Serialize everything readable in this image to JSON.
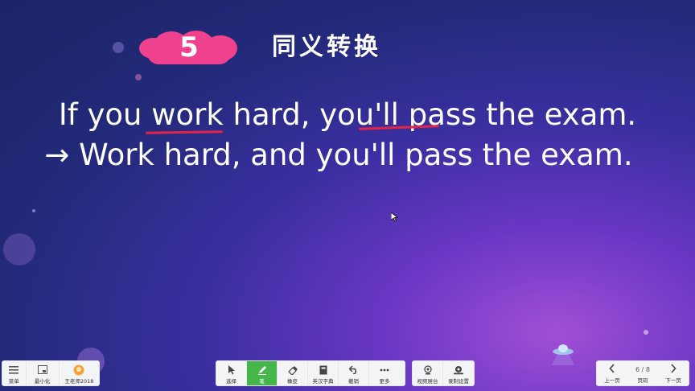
{
  "slide": {
    "badge_number": "5",
    "section_title": "同义转换",
    "sentence_1": "If you work hard, you'll pass the exam.",
    "sentence_2": "→ Work hard, and you'll pass the exam."
  },
  "colors": {
    "badge": "#f0418f",
    "underline": "#e0244a",
    "active_tool": "#45b649"
  },
  "toolbar": {
    "left": [
      {
        "label": "菜单",
        "icon": "menu-icon"
      },
      {
        "label": "最小化",
        "icon": "minimize-icon"
      },
      {
        "label": "王老师2018",
        "icon": "avatar-icon"
      }
    ],
    "center_tools": [
      {
        "label": "选择",
        "icon": "pointer-icon"
      },
      {
        "label": "笔",
        "icon": "pen-icon"
      },
      {
        "label": "橡皮",
        "icon": "eraser-icon"
      },
      {
        "label": "英汉字典",
        "icon": "dictionary-icon"
      },
      {
        "label": "撤销",
        "icon": "undo-icon"
      },
      {
        "label": "更多",
        "icon": "more-icon"
      }
    ],
    "center_right": [
      {
        "label": "视频展台",
        "icon": "camera-icon"
      },
      {
        "label": "录制设置",
        "icon": "record-icon"
      }
    ],
    "pager": {
      "prev_label": "上一页",
      "page_text": "6 / 8",
      "page_label": "页码",
      "next_label": "下一页"
    }
  }
}
